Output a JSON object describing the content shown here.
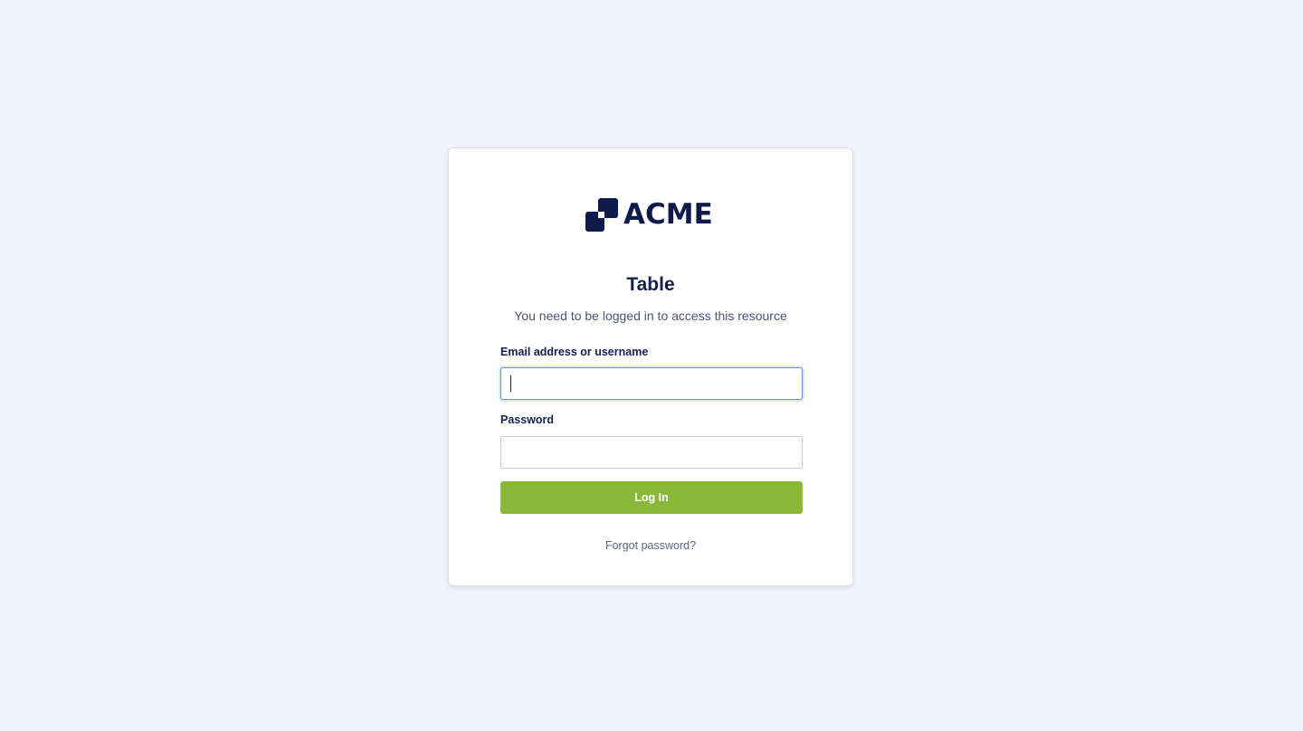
{
  "brand": {
    "name": "ACME",
    "color": "#0f1a4d"
  },
  "login": {
    "title": "Table",
    "subtitle": "You need to be logged in to access this resource",
    "email_label": "Email address or username",
    "email_value": "",
    "password_label": "Password",
    "password_value": "",
    "submit_label": "Log In",
    "forgot_label": "Forgot password?"
  },
  "colors": {
    "background": "#f2f3fc",
    "card": "#ffffff",
    "primary_button": "#8ab93a",
    "focus_border": "#6f8fd8",
    "text_dark": "#15204d",
    "text_muted": "#4d5478"
  },
  "icons": {
    "logo": "acme-squares-logo-icon"
  }
}
